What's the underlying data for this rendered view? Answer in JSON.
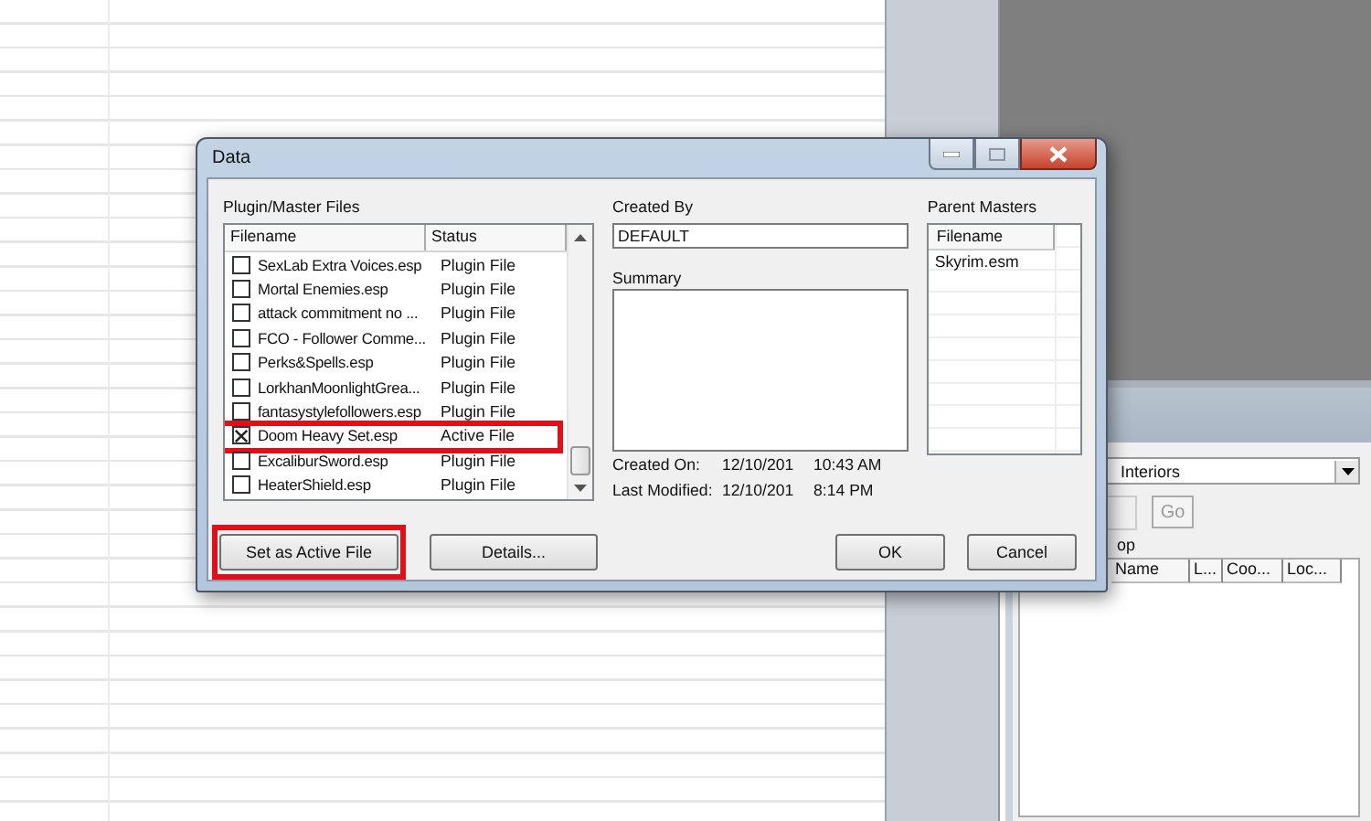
{
  "background_window": {
    "dropdown_value": "Interiors",
    "go_button": "Go",
    "label": "op",
    "columns": [
      "Name",
      "L...",
      "Coo...",
      "Loc..."
    ]
  },
  "dialog": {
    "title": "Data",
    "files_label": "Plugin/Master Files",
    "files_columns": [
      "Filename",
      "Status"
    ],
    "files": [
      {
        "filename": "SexLab Extra Voices.esp",
        "status": "Plugin File",
        "checked": false,
        "highlighted": false
      },
      {
        "filename": "Mortal Enemies.esp",
        "status": "Plugin File",
        "checked": false,
        "highlighted": false
      },
      {
        "filename": "attack commitment no ...",
        "status": "Plugin File",
        "checked": false,
        "highlighted": false
      },
      {
        "filename": "FCO - Follower Comme...",
        "status": "Plugin File",
        "checked": false,
        "highlighted": false
      },
      {
        "filename": "Perks&Spells.esp",
        "status": "Plugin File",
        "checked": false,
        "highlighted": false
      },
      {
        "filename": "LorkhanMoonlightGrea...",
        "status": "Plugin File",
        "checked": false,
        "highlighted": false
      },
      {
        "filename": "fantasystylefollowers.esp",
        "status": "Plugin File",
        "checked": false,
        "highlighted": false
      },
      {
        "filename": "Doom Heavy Set.esp",
        "status": "Active File",
        "checked": true,
        "highlighted": true
      },
      {
        "filename": "ExcaliburSword.esp",
        "status": "Plugin File",
        "checked": false,
        "highlighted": false
      },
      {
        "filename": "HeaterShield.esp",
        "status": "Plugin File",
        "checked": false,
        "highlighted": false
      }
    ],
    "created_by_label": "Created By",
    "created_by": "DEFAULT",
    "summary_label": "Summary",
    "created_on_label": "Created On:",
    "created_on_date": "12/10/201",
    "created_on_time": "10:43 AM",
    "last_modified_label": "Last Modified:",
    "last_modified_date": "12/10/201",
    "last_modified_time": "8:14 PM",
    "parent_masters_label": "Parent Masters",
    "parent_masters_columns": [
      "Filename"
    ],
    "parent_masters": [
      "Skyrim.esm"
    ],
    "buttons": [
      {
        "label": "Set as Active File",
        "kind": "left",
        "highlighted": true
      },
      {
        "label": "Details...",
        "kind": "left",
        "highlighted": false
      },
      {
        "label": "OK",
        "kind": "right",
        "highlighted": false
      },
      {
        "label": "Cancel",
        "kind": "right",
        "highlighted": false
      }
    ]
  }
}
